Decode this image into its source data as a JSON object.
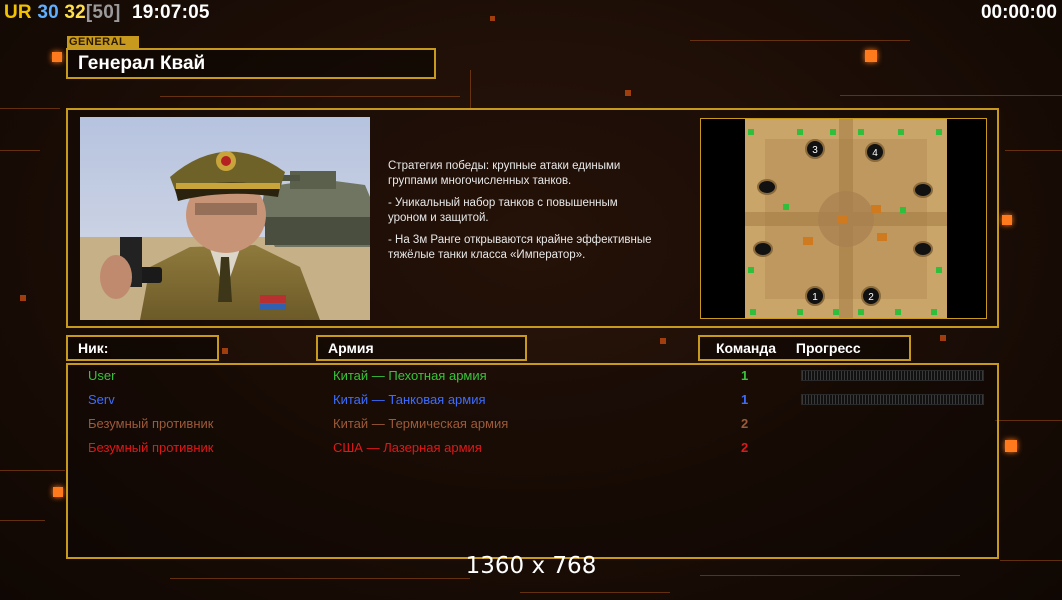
{
  "topbar": {
    "ur": "UR",
    "num_a": "30",
    "num_b": "32",
    "num_c": "[50]",
    "clock": "19:07:05",
    "timer": "00:00:00"
  },
  "general": {
    "tag": "GENERAL",
    "name": "Генерал Квай"
  },
  "strategy": {
    "paragraphs": [
      "Стратегия победы: крупные атаки едиными\n группами многочисленных танков.",
      "- Уникальный набор танков с повышенным\n уроном и защитой.",
      "- На 3м Ранге открываются крайне эффективные\n тяжёлые танки класса «Император»."
    ]
  },
  "map": {
    "spawn_labels": [
      "3",
      "4",
      "1",
      "2"
    ]
  },
  "headers": {
    "nick": "Ник:",
    "army": "Армия",
    "team": "Команда",
    "progress": "Прогресс"
  },
  "players": [
    {
      "nick": "User",
      "army": "Китай — Пехотная армия",
      "team": "1",
      "color": "#39c23a",
      "progress": 0
    },
    {
      "nick": "Serv",
      "army": "Китай — Танковая армия",
      "team": "1",
      "color": "#3d6cff",
      "progress": 0
    },
    {
      "nick": "Безумный противник",
      "army": "Китай — Термическая армия",
      "team": "2",
      "color": "#9c5a3a",
      "progress": null
    },
    {
      "nick": "Безумный противник",
      "army": "США — Лазерная армия",
      "team": "2",
      "color": "#e01818",
      "progress": null
    }
  ],
  "resolution": "1360 x 768",
  "colors": {
    "frame": "#c79a1e",
    "accent": "#ff7a1c",
    "background": "#1c0f08"
  }
}
